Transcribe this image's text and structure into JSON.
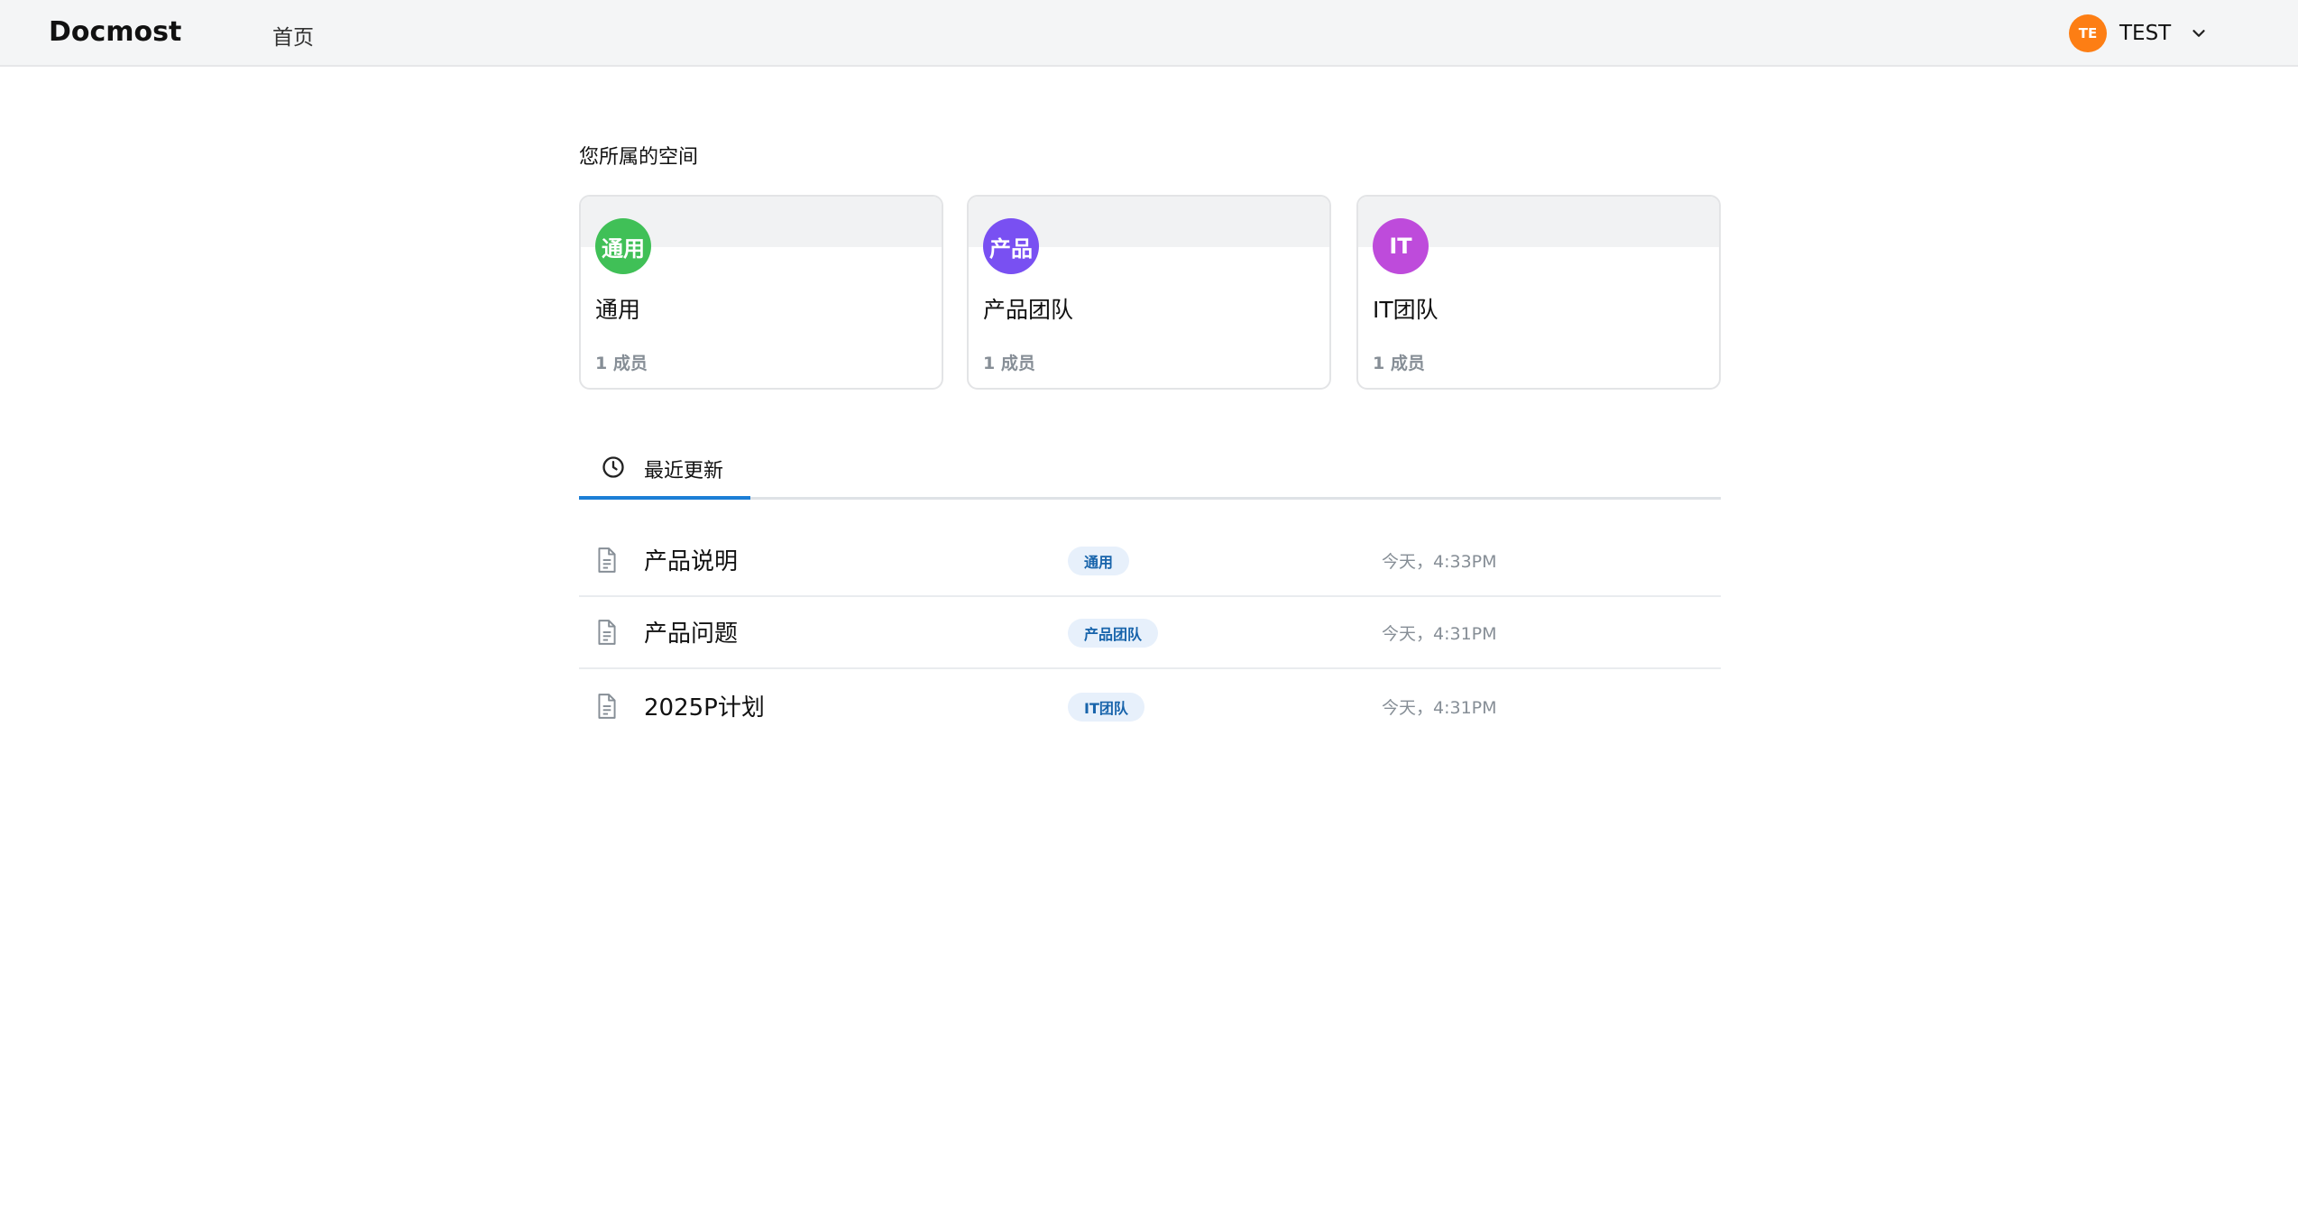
{
  "header": {
    "brand": "Docmost",
    "nav_home": "首页",
    "user": {
      "initials": "TE",
      "name": "TEST",
      "avatar_color": "#fd7e14"
    }
  },
  "spaces_section": {
    "title": "您所属的空间",
    "cards": [
      {
        "avatar_text": "通用",
        "avatar_color": "#40c057",
        "name": "通用",
        "members": "1 成员"
      },
      {
        "avatar_text": "产品",
        "avatar_color": "#7950f2",
        "name": "产品团队",
        "members": "1 成员"
      },
      {
        "avatar_text": "IT",
        "avatar_color": "#be4bdb",
        "name": "IT团队",
        "members": "1 成员"
      }
    ]
  },
  "tabs": [
    {
      "label": "最近更新",
      "icon": "clock-icon",
      "active": true
    }
  ],
  "recent": [
    {
      "icon": "file-icon",
      "title": "产品说明",
      "space": "通用",
      "updated": "今天，4:33PM"
    },
    {
      "icon": "file-icon",
      "title": "产品问题",
      "space": "产品团队",
      "updated": "今天，4:31PM"
    },
    {
      "icon": "file-icon",
      "title": "2025P计划",
      "space": "IT团队",
      "updated": "今天，4:31PM"
    }
  ],
  "colors": {
    "accent": "#1c7ed6",
    "badge_bg": "#e7f0fb",
    "badge_text": "#1864ab",
    "muted_text": "#868e96"
  }
}
